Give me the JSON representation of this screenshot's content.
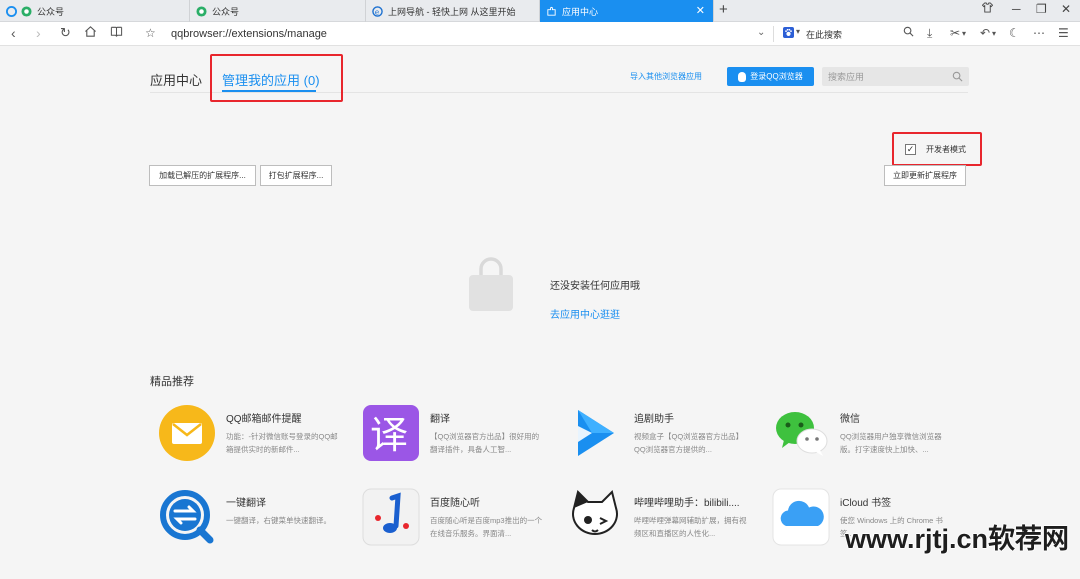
{
  "tabs": [
    {
      "label": "公众号"
    },
    {
      "label": "公众号"
    },
    {
      "label": "上网导航 - 轻快上网 从这里开始"
    },
    {
      "label": "应用中心"
    }
  ],
  "addressbar": {
    "url": "qqbrowser://extensions/manage",
    "search_label": "在此搜索"
  },
  "header": {
    "title": "应用中心",
    "manage_label": "管理我的应用",
    "manage_count": "(0)",
    "import_link": "导入其他浏览器应用",
    "login_button": "登录QQ浏览器",
    "search_placeholder": "搜索应用"
  },
  "toolbar": {
    "dev_mode_label": "开发者模式",
    "dev_mode_checked": true,
    "load_unpacked": "加载已解压的扩展程序...",
    "pack": "打包扩展程序...",
    "update_now": "立即更新扩展程序"
  },
  "empty_state": {
    "text": "还没安装任何应用哦",
    "link": "去应用中心逛逛"
  },
  "recommend": {
    "title": "精品推荐",
    "apps": [
      {
        "name": "QQ邮箱邮件提醒",
        "desc": "功能：-针对微信账号登录的QQ邮箱提供实时的新邮件...",
        "icon": "mail-icon"
      },
      {
        "name": "翻译",
        "desc": "【QQ浏览器官方出品】很好用的翻译插件，具备人工智...",
        "icon": "translate-icon"
      },
      {
        "name": "追剧助手",
        "desc": "视频盒子【QQ浏览器官方出品】QQ浏览器官方提供的...",
        "icon": "play-icon"
      },
      {
        "name": "微信",
        "desc": "QQ浏览器用户独享微信浏览器版。打字速度快上加快、...",
        "icon": "wechat-icon"
      },
      {
        "name": "一键翻译",
        "desc": "一键翻译，右键菜单快速翻译。",
        "icon": "exchange-icon"
      },
      {
        "name": "百度随心听",
        "desc": "百度随心听是百度mp3推出的一个在线音乐服务。界面清...",
        "icon": "music-note-icon"
      },
      {
        "name": "哔哩哔哩助手：bilibili....",
        "desc": "哔哩哔哩弹幕网辅助扩展，拥有视频区和直播区的人性化...",
        "icon": "cat-icon"
      },
      {
        "name": "iCloud 书签",
        "desc": "使您 Windows 上的 Chrome 书签...",
        "icon": "cloud-icon"
      }
    ]
  },
  "watermark": "www.rjtj.cn软荐网"
}
